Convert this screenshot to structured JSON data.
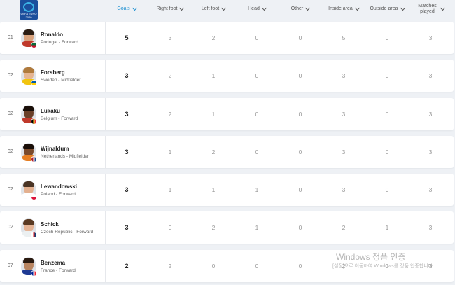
{
  "header": {
    "logo_alt": "UEFA EURO 2020",
    "columns": [
      {
        "label": "Goals",
        "active": true
      },
      {
        "label": "Right foot",
        "active": false
      },
      {
        "label": "Left foot",
        "active": false
      },
      {
        "label": "Head",
        "active": false
      },
      {
        "label": "Other",
        "active": false
      },
      {
        "label": "Inside area",
        "active": false
      },
      {
        "label": "Outside area",
        "active": false
      },
      {
        "label": "Matches played",
        "active": false
      }
    ]
  },
  "rows": [
    {
      "rank": "01",
      "name": "Ronaldo",
      "info": "Portugal - Forward",
      "goals": "5",
      "right_foot": "3",
      "left_foot": "2",
      "head": "0",
      "other": "0",
      "inside_area": "5",
      "outside_area": "0",
      "matches": "3"
    },
    {
      "rank": "02",
      "name": "Forsberg",
      "info": "Sweden - Midfielder",
      "goals": "3",
      "right_foot": "2",
      "left_foot": "1",
      "head": "0",
      "other": "0",
      "inside_area": "3",
      "outside_area": "0",
      "matches": "3"
    },
    {
      "rank": "02",
      "name": "Lukaku",
      "info": "Belgium - Forward",
      "goals": "3",
      "right_foot": "2",
      "left_foot": "1",
      "head": "0",
      "other": "0",
      "inside_area": "3",
      "outside_area": "0",
      "matches": "3"
    },
    {
      "rank": "02",
      "name": "Wijnaldum",
      "info": "Netherlands - Midfielder",
      "goals": "3",
      "right_foot": "1",
      "left_foot": "2",
      "head": "0",
      "other": "0",
      "inside_area": "3",
      "outside_area": "0",
      "matches": "3"
    },
    {
      "rank": "02",
      "name": "Lewandowski",
      "info": "Poland - Forward",
      "goals": "3",
      "right_foot": "1",
      "left_foot": "1",
      "head": "1",
      "other": "0",
      "inside_area": "3",
      "outside_area": "0",
      "matches": "3"
    },
    {
      "rank": "02",
      "name": "Schick",
      "info": "Czech Republic - Forward",
      "goals": "3",
      "right_foot": "0",
      "left_foot": "2",
      "head": "1",
      "other": "0",
      "inside_area": "2",
      "outside_area": "1",
      "matches": "3"
    },
    {
      "rank": "07",
      "name": "Benzema",
      "info": "France - Forward",
      "goals": "2",
      "right_foot": "2",
      "left_foot": "0",
      "head": "0",
      "other": "0",
      "inside_area": "2",
      "outside_area": "0",
      "matches": "3"
    }
  ],
  "colors": {
    "accent": "#1a8fd1",
    "background": "#eef1f5"
  },
  "watermark": {
    "title": "Windows 정품 인증",
    "subtitle": "[설정]으로 이동하여 Windows를 정품 인증합니다."
  }
}
